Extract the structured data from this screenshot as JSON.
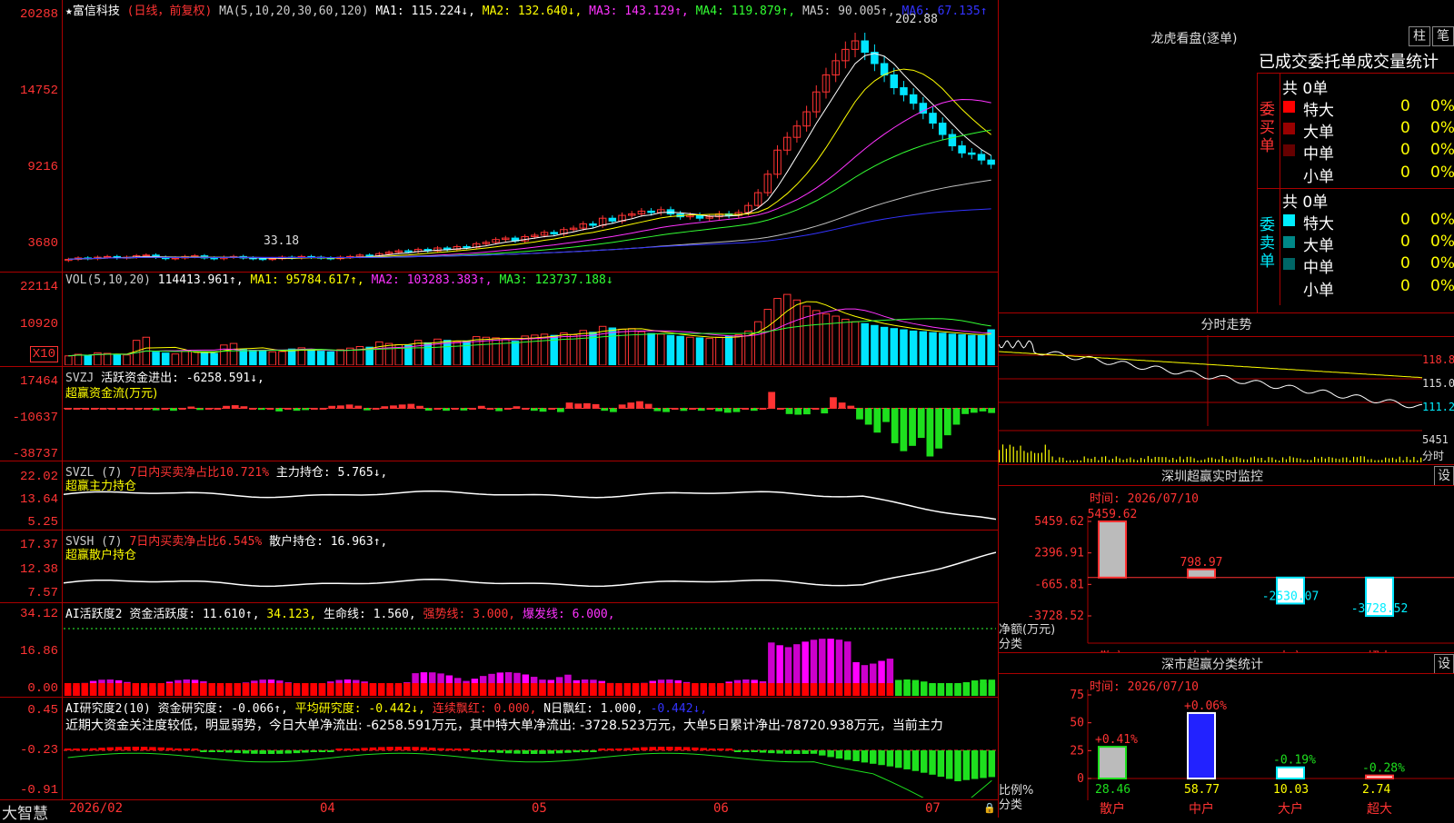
{
  "colors": {
    "up": "#ff3333",
    "down": "#00e5ff",
    "ma1": "#ffffff",
    "ma2": "#ffff00",
    "ma3": "#ff33ff",
    "ma4": "#33ff33",
    "ma5": "#c0c0c0",
    "ma6": "#3333ff",
    "axis": "#ff3333",
    "grid": "#aa0000"
  },
  "header": {
    "stock": "★富信科技",
    "mode": "(日线，前复权)",
    "ma_def": "MA(5,10,20,30,60,120)",
    "ma1": "MA1: 115.224↓,",
    "ma2": "MA2: 132.640↓,",
    "ma3": "MA3: 143.129↑,",
    "ma4": "MA4: 119.879↑,",
    "ma5": "MA5: 90.005↑,",
    "ma6": "MA6: 67.135↑"
  },
  "price_pane": {
    "y_labels": [
      "20288",
      "14752",
      "9216",
      "3680"
    ],
    "high_label": "202.88",
    "low_label": "33.18",
    "chart_data": {
      "type": "candlestick",
      "ylim": [
        3000,
        20800
      ],
      "closes": [
        3800,
        3900,
        3850,
        3950,
        4000,
        3900,
        3950,
        4050,
        4100,
        3950,
        3850,
        3900,
        4000,
        4050,
        3900,
        3850,
        3950,
        4000,
        3900,
        3850,
        3800,
        3850,
        3950,
        3900,
        4000,
        3950,
        3900,
        3850,
        3950,
        4000,
        4100,
        4050,
        4200,
        4300,
        4400,
        4350,
        4500,
        4400,
        4600,
        4500,
        4700,
        4650,
        4900,
        5000,
        5200,
        5300,
        5100,
        5400,
        5500,
        5700,
        5600,
        5900,
        6000,
        6300,
        6200,
        6700,
        6500,
        6900,
        7000,
        7200,
        7100,
        7300,
        7000,
        6800,
        6900,
        6700,
        6800,
        7000,
        6900,
        7100,
        7600,
        8500,
        9800,
        11500,
        12400,
        13200,
        14200,
        15600,
        16800,
        17800,
        18600,
        19200,
        18400,
        17600,
        16800,
        15900,
        15400,
        14800,
        14100,
        13400,
        12600,
        11800,
        11300,
        11200,
        10800,
        10500
      ]
    }
  },
  "vol_pane": {
    "header": "VOL(5,10,20)",
    "value": "114413.961↑,",
    "ma1": "MA1: 95784.617↑,",
    "ma2": "MA2: 103283.383↑,",
    "ma3": "MA3: 123737.188↓",
    "y_labels": [
      "22114",
      "10920"
    ],
    "unit": "X10",
    "chart_data": {
      "type": "bar",
      "ylim": [
        0,
        24000
      ],
      "values": [
        3000,
        3500,
        3200,
        4000,
        3800,
        3500,
        3300,
        8000,
        9000,
        4200,
        3900,
        3600,
        4500,
        4400,
        4100,
        3800,
        6500,
        7000,
        5000,
        4800,
        4600,
        4300,
        4400,
        5200,
        5600,
        4800,
        4500,
        4300,
        5000,
        5500,
        6000,
        5800,
        7500,
        7000,
        6600,
        6400,
        8000,
        7200,
        8400,
        8000,
        7600,
        7800,
        9200,
        9000,
        8800,
        8300,
        7700,
        9400,
        9700,
        10000,
        9600,
        10400,
        9800,
        11200,
        10600,
        12500,
        12000,
        11600,
        11800,
        10800,
        10200,
        10000,
        9600,
        9300,
        9000,
        8800,
        8600,
        9000,
        9400,
        9800,
        11000,
        14000,
        18000,
        21500,
        22800,
        21000,
        19000,
        17600,
        16500,
        15800,
        14800,
        14000,
        13400,
        12800,
        12200,
        11800,
        11400,
        11000,
        10800,
        10500,
        10300,
        10000,
        9800,
        9600,
        9500,
        11400
      ]
    }
  },
  "svzj_pane": {
    "header": "SVZJ",
    "title": "活跃资金进出: -6258.591↓,",
    "sub": "超赢资金流(万元)",
    "y_labels": [
      "17464",
      "-10637",
      "-38737"
    ],
    "chart_data": {
      "type": "bar",
      "ylim": [
        -38737,
        17464
      ],
      "values": [
        0,
        0,
        0,
        0,
        0,
        0,
        0,
        0,
        0,
        0,
        -1200,
        0,
        -1500,
        0,
        1000,
        -900,
        0,
        0,
        1500,
        2000,
        1200,
        0,
        -800,
        0,
        -2000,
        0,
        -1500,
        -1000,
        0,
        0,
        1500,
        1800,
        2500,
        1600,
        -1200,
        0,
        1200,
        1800,
        2500,
        3000,
        1500,
        -1400,
        0,
        -1500,
        0,
        -1300,
        0,
        1500,
        0,
        -1800,
        0,
        1200,
        0,
        -1500,
        -2200,
        0,
        -2500,
        4000,
        3200,
        3500,
        2800,
        -1500,
        -2500,
        2500,
        4000,
        5000,
        3000,
        -1800,
        -2500,
        0,
        -1600,
        0,
        -1500,
        0,
        -1900,
        -3000,
        -2500,
        0,
        -1500,
        0,
        12000,
        0,
        -4000,
        -4500,
        -4200,
        0,
        -3500,
        8000,
        4000,
        1600,
        -8000,
        -12000,
        -18000,
        -10000,
        -26000,
        -32000,
        -28000,
        -22000,
        -36000,
        -30000,
        -20000,
        -12000,
        -4000,
        -3000,
        -2000,
        -3200
      ]
    }
  },
  "svzl_pane": {
    "header": "SVZL (7)",
    "info": "7日内买卖净占比10.721%",
    "hold": "主力持仓: 5.765↓,",
    "sub": "超赢主力持仓",
    "y_labels": [
      "22.02",
      "13.64",
      "5.25"
    ]
  },
  "svsh_pane": {
    "header": "SVSH (7)",
    "info": "7日内买卖净占比6.545%",
    "hold": "散户持仓: 16.963↑,",
    "sub": "超赢散户持仓",
    "y_labels": [
      "17.37",
      "12.38",
      "7.57"
    ]
  },
  "ai_pane": {
    "header": "AI活跃度2",
    "v1": "资金活跃度: 11.610↑,",
    "v2": "34.123,",
    "v3": "生命线: 1.560,",
    "v4": "强势线: 3.000,",
    "v5": "爆发线: 6.000,",
    "y_labels": [
      "34.12",
      "16.86",
      "0.00"
    ]
  },
  "research_pane": {
    "header": "AI研究度2(10)",
    "v1": "资金研究度: -0.066↑,",
    "v2": "平均研究度: -0.442↓,",
    "v3": "连续飘红: 0.000,",
    "v4": "N日飘红: 1.000,",
    "v5": "-0.442↓,",
    "comment": "近期大资金关注度较低，明显弱势，今日大单净流出: -6258.591万元，其中特大单净流出: -3728.523万元，大单5日累计净出-78720.938万元，当前主力",
    "y_labels": [
      "0.45",
      "-0.23",
      "-0.91"
    ]
  },
  "bottom": {
    "logo": "大智慧",
    "dates": [
      "2026/02",
      "04",
      "05",
      "06",
      "07"
    ]
  },
  "dragon": {
    "title": "龙虎看盘(逐单)",
    "btn1": "柱",
    "btn2": "笔",
    "subtitle": "已成交委托单成交量统计",
    "buy": {
      "label": "委买单",
      "total": "共 0单",
      "rows": [
        {
          "name": "特大",
          "v": "0",
          "p": "0%",
          "c": "#ff0000"
        },
        {
          "name": "大单",
          "v": "0",
          "p": "0%",
          "c": "#990000"
        },
        {
          "name": "中单",
          "v": "0",
          "p": "0%",
          "c": "#660000"
        },
        {
          "name": "小单",
          "v": "0",
          "p": "0%",
          "c": "#000000"
        }
      ]
    },
    "sell": {
      "label": "委卖单",
      "total": "共 0单",
      "rows": [
        {
          "name": "特大",
          "v": "0",
          "p": "0%",
          "c": "#00e5ff"
        },
        {
          "name": "大单",
          "v": "0",
          "p": "0%",
          "c": "#008b8b"
        },
        {
          "name": "中单",
          "v": "0",
          "p": "0%",
          "c": "#006a6a"
        },
        {
          "name": "小单",
          "v": "0",
          "p": "0%",
          "c": "#000000"
        }
      ]
    }
  },
  "intraday": {
    "title": "分时走势",
    "y_labels": [
      "118.8",
      "115.0",
      "111.2"
    ],
    "vol_label": "5451",
    "unit": "分时"
  },
  "monitor": {
    "title": "深圳超赢实时监控",
    "btn": "设",
    "time": "时间: 2026/07/10",
    "y_labels": [
      "5459.62",
      "2396.91",
      "-665.81",
      "-3728.52"
    ],
    "ylabel": "净额(万元)",
    "xlabel": "分类",
    "chart_data": {
      "type": "bar",
      "categories": [
        "散户",
        "中户",
        "大户",
        "超大"
      ],
      "values": [
        5459.62,
        798.97,
        -2530.07,
        -3728.52
      ],
      "ylim": [
        -3728.52,
        5459.62
      ]
    },
    "value_labels": [
      "5459.62",
      "798.97",
      "-2530.07",
      "-3728.52"
    ]
  },
  "classify": {
    "title": "深市超赢分类统计",
    "btn": "设",
    "time": "时间: 2026/07/10",
    "y_labels": [
      "75",
      "50",
      "25",
      "0"
    ],
    "ylabel": "比例%",
    "xlabel": "分类",
    "chart_data": {
      "type": "bar",
      "categories": [
        "散户",
        "中户",
        "大户",
        "超大"
      ],
      "values": [
        28.46,
        58.77,
        10.03,
        2.74
      ],
      "ylim": [
        0,
        75
      ]
    },
    "change_labels": [
      "+0.41%",
      "+0.06%",
      "-0.19%",
      "-0.28%"
    ],
    "value_labels": [
      "28.46",
      "58.77",
      "10.03",
      "2.74"
    ]
  }
}
